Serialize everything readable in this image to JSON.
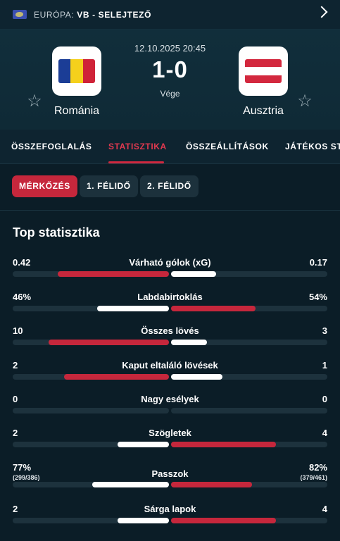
{
  "competition": {
    "region": "EURÓPA:",
    "name": "VB - SELEJTEZŐ"
  },
  "match": {
    "datetime": "12.10.2025 20:45",
    "score": "1-0",
    "status": "Vége",
    "home": {
      "name": "Románia"
    },
    "away": {
      "name": "Ausztria"
    }
  },
  "tabs": [
    "ÖSSZEFOGLALÁS",
    "STATISZTIKA",
    "ÖSSZEÁLLÍTÁSOK",
    "JÁTÉKOS STA"
  ],
  "subtabs": [
    "MÉRKŐZÉS",
    "1. FÉLIDŐ",
    "2. FÉLIDŐ"
  ],
  "section_title": "Top statisztika",
  "colors": {
    "home_bar": "#c6273c",
    "away_bar": "#ffffff",
    "accent": "#d0283f"
  },
  "stats": [
    {
      "name": "Várható gólok (xG)",
      "home": "0.42",
      "away": "0.17",
      "home_sub": "",
      "away_sub": "",
      "home_frac": 0.71,
      "away_frac": 0.29,
      "home_win": true
    },
    {
      "name": "Labdabirtoklás",
      "home": "46%",
      "away": "54%",
      "home_sub": "",
      "away_sub": "",
      "home_frac": 0.46,
      "away_frac": 0.54,
      "home_win": false
    },
    {
      "name": "Összes lövés",
      "home": "10",
      "away": "3",
      "home_sub": "",
      "away_sub": "",
      "home_frac": 0.77,
      "away_frac": 0.23,
      "home_win": true
    },
    {
      "name": "Kaput eltaláló lövések",
      "home": "2",
      "away": "1",
      "home_sub": "",
      "away_sub": "",
      "home_frac": 0.67,
      "away_frac": 0.33,
      "home_win": true
    },
    {
      "name": "Nagy esélyek",
      "home": "0",
      "away": "0",
      "home_sub": "",
      "away_sub": "",
      "home_frac": 0,
      "away_frac": 0,
      "home_win": false
    },
    {
      "name": "Szögletek",
      "home": "2",
      "away": "4",
      "home_sub": "",
      "away_sub": "",
      "home_frac": 0.33,
      "away_frac": 0.67,
      "home_win": false
    },
    {
      "name": "Passzok",
      "home": "77%",
      "away": "82%",
      "home_sub": "(299/386)",
      "away_sub": "(379/461)",
      "home_frac": 0.49,
      "away_frac": 0.52,
      "home_win": false
    },
    {
      "name": "Sárga lapok",
      "home": "2",
      "away": "4",
      "home_sub": "",
      "away_sub": "",
      "home_frac": 0.33,
      "away_frac": 0.67,
      "home_win": false
    }
  ]
}
